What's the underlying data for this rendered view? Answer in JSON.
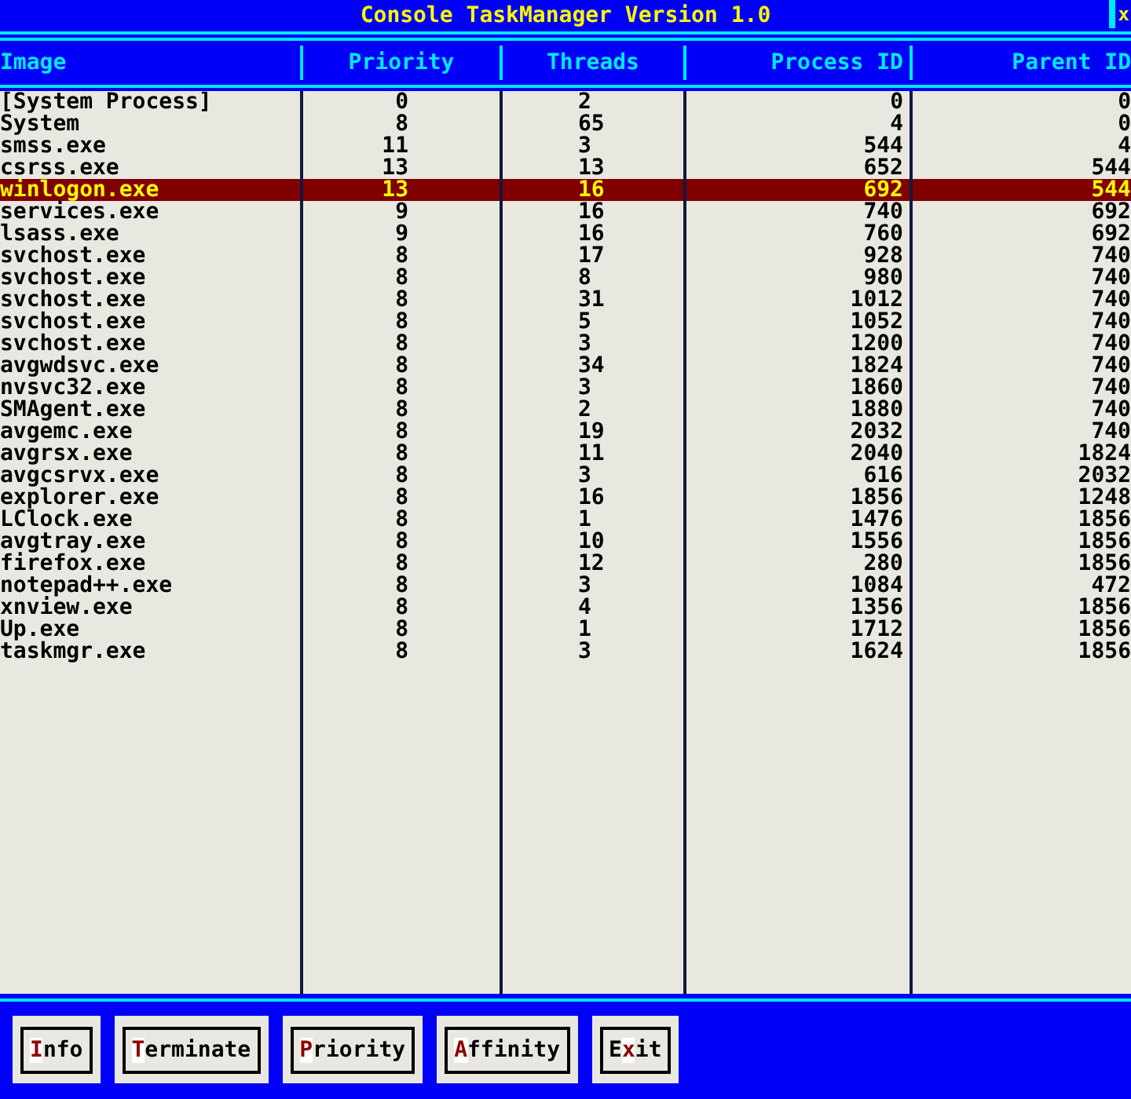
{
  "window": {
    "title": "Console TaskManager Version 1.0",
    "close": "x"
  },
  "table": {
    "columns": [
      "Image",
      "Priority",
      "Threads",
      "Process ID",
      "Parent ID"
    ],
    "rows": [
      {
        "cells": [
          "[System Process]",
          "0",
          "2",
          "0",
          "0"
        ],
        "selected": false
      },
      {
        "cells": [
          "System",
          "8",
          "65",
          "4",
          "0"
        ],
        "selected": false
      },
      {
        "cells": [
          "smss.exe",
          "11",
          "3",
          "544",
          "4"
        ],
        "selected": false
      },
      {
        "cells": [
          "csrss.exe",
          "13",
          "13",
          "652",
          "544"
        ],
        "selected": false
      },
      {
        "cells": [
          "winlogon.exe",
          "13",
          "16",
          "692",
          "544"
        ],
        "selected": true
      },
      {
        "cells": [
          "services.exe",
          "9",
          "16",
          "740",
          "692"
        ],
        "selected": false
      },
      {
        "cells": [
          "lsass.exe",
          "9",
          "16",
          "760",
          "692"
        ],
        "selected": false
      },
      {
        "cells": [
          "svchost.exe",
          "8",
          "17",
          "928",
          "740"
        ],
        "selected": false
      },
      {
        "cells": [
          "svchost.exe",
          "8",
          "8",
          "980",
          "740"
        ],
        "selected": false
      },
      {
        "cells": [
          "svchost.exe",
          "8",
          "31",
          "1012",
          "740"
        ],
        "selected": false
      },
      {
        "cells": [
          "svchost.exe",
          "8",
          "5",
          "1052",
          "740"
        ],
        "selected": false
      },
      {
        "cells": [
          "svchost.exe",
          "8",
          "3",
          "1200",
          "740"
        ],
        "selected": false
      },
      {
        "cells": [
          "avgwdsvc.exe",
          "8",
          "34",
          "1824",
          "740"
        ],
        "selected": false
      },
      {
        "cells": [
          "nvsvc32.exe",
          "8",
          "3",
          "1860",
          "740"
        ],
        "selected": false
      },
      {
        "cells": [
          "SMAgent.exe",
          "8",
          "2",
          "1880",
          "740"
        ],
        "selected": false
      },
      {
        "cells": [
          "avgemc.exe",
          "8",
          "19",
          "2032",
          "740"
        ],
        "selected": false
      },
      {
        "cells": [
          "avgrsx.exe",
          "8",
          "11",
          "2040",
          "1824"
        ],
        "selected": false
      },
      {
        "cells": [
          "avgcsrvx.exe",
          "8",
          "3",
          "616",
          "2032"
        ],
        "selected": false
      },
      {
        "cells": [
          "explorer.exe",
          "8",
          "16",
          "1856",
          "1248"
        ],
        "selected": false
      },
      {
        "cells": [
          "LClock.exe",
          "8",
          "1",
          "1476",
          "1856"
        ],
        "selected": false
      },
      {
        "cells": [
          "avgtray.exe",
          "8",
          "10",
          "1556",
          "1856"
        ],
        "selected": false
      },
      {
        "cells": [
          "firefox.exe",
          "8",
          "12",
          "280",
          "1856"
        ],
        "selected": false
      },
      {
        "cells": [
          "notepad++.exe",
          "8",
          "3",
          "1084",
          "472"
        ],
        "selected": false
      },
      {
        "cells": [
          "xnview.exe",
          "8",
          "4",
          "1356",
          "1856"
        ],
        "selected": false
      },
      {
        "cells": [
          "Up.exe",
          "8",
          "1",
          "1712",
          "1856"
        ],
        "selected": false
      },
      {
        "cells": [
          "taskmgr.exe",
          "8",
          "3",
          "1624",
          "1856"
        ],
        "selected": false
      }
    ]
  },
  "buttons": [
    {
      "label": "**I**nfo"
    },
    {
      "label": "**T**erminate"
    },
    {
      "label": "**P**riority"
    },
    {
      "label": "**A**ffinity"
    },
    {
      "label": "E**x**it"
    }
  ]
}
